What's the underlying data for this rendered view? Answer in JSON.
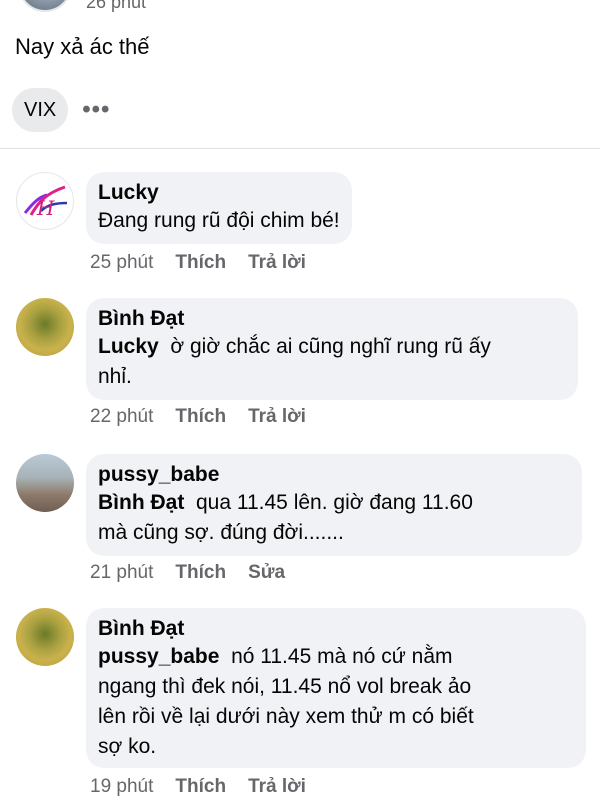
{
  "post": {
    "time": "26 phút",
    "text": "Nay xả ác thế",
    "tag_chip": "VIX",
    "more": "•••"
  },
  "comments": [
    {
      "author": "Lucky",
      "mention": "",
      "text": "Đang rung rũ đội chim bé!",
      "time": "25 phút",
      "like": "Thích",
      "action": "Trả lời",
      "avatar_text": "H"
    },
    {
      "author": "Bình Đạt",
      "mention": "Lucky",
      "text_line1": "ờ giờ chắc ai cũng nghĩ rung rũ ấy",
      "text_line2": "nhỉ.",
      "time": "22 phút",
      "like": "Thích",
      "action": "Trả lời"
    },
    {
      "author": "pussy_babe",
      "mention": "Bình Đạt",
      "text_line1": "qua 11.45 lên. giờ đang 11.60",
      "text_line2": "mà cũng sợ. đúng đời.......",
      "time": "21 phút",
      "like": "Thích",
      "action": "Sửa"
    },
    {
      "author": "Bình Đạt",
      "mention": "pussy_babe",
      "text_line1": "nó 11.45 mà nó cứ nằm",
      "text_line2": "ngang thì đek nói, 11.45 nổ vol break ảo",
      "text_line3": "lên rồi về lại dưới này xem thử m có biết",
      "text_line4": "sợ ko.",
      "time": "19 phút",
      "like": "Thích",
      "action": "Trả lời"
    }
  ],
  "colors": {
    "bubble": "#f0f2f5",
    "meta_text": "#65676b",
    "text": "#050505"
  }
}
